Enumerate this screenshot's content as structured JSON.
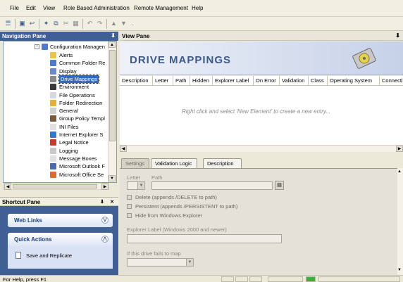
{
  "menu": [
    "File",
    "Edit",
    "View",
    "Role Based Administration",
    "Remote Management",
    "Help"
  ],
  "toolbar": {
    "icons": [
      "list-icon",
      "save-icon",
      "back-icon",
      "wand-icon",
      "copy-icon",
      "cut-icon",
      "paste-icon",
      "undo-icon",
      "redo-icon",
      "up-arrow-icon",
      "down-arrow-icon",
      "more-icon"
    ]
  },
  "nav_pane": {
    "title": "Navigation Pane",
    "pin": "⬇",
    "root": "Configuration Managen",
    "items": [
      {
        "label": "Alerts",
        "color": "#e8c547"
      },
      {
        "label": "Common Folder Re",
        "color": "#4a7bd0"
      },
      {
        "label": "Display",
        "color": "#6a8ad0"
      },
      {
        "label": "Drive Mappings",
        "color": "#8a8a8a",
        "selected": true
      },
      {
        "label": "Environment",
        "color": "#3a3a3a"
      },
      {
        "label": "File Operations",
        "color": "#d8d8d8"
      },
      {
        "label": "Folder Redirection",
        "color": "#e8b030"
      },
      {
        "label": "General",
        "color": "#d0d0d0"
      },
      {
        "label": "Group Policy Templ",
        "color": "#7a5a3a"
      },
      {
        "label": "INI Files",
        "color": "#e0e0e0"
      },
      {
        "label": "Internet Explorer S",
        "color": "#2a7ad8"
      },
      {
        "label": "Legal Notice",
        "color": "#c83a2a"
      },
      {
        "label": "Logging",
        "color": "#c8c8c8"
      },
      {
        "label": "Message Boxes",
        "color": "#e0e0e0"
      },
      {
        "label": "Microsoft Outlook F",
        "color": "#4a6ab0"
      },
      {
        "label": "Microsoft Office Se",
        "color": "#e06a2a"
      }
    ]
  },
  "shortcut_pane": {
    "title": "Shortcut Pane",
    "pin": "⬇",
    "close": "✕",
    "web_links": "Web Links",
    "quick_actions": "Quick Actions",
    "action": "Save and Replicate",
    "chev_down": "⌵",
    "chev_up": "⌃"
  },
  "view_pane": {
    "title": "View Pane",
    "pin": "⬇",
    "banner_title": "DRIVE MAPPINGS",
    "columns": [
      "Description",
      "Letter",
      "Path",
      "Hidden",
      "Explorer Label",
      "On Error",
      "Validation",
      "Class",
      "Operating System",
      "Connecti"
    ],
    "hint": "Right click and select 'New Element' to create a new entry...",
    "tabs": [
      "Settings",
      "Validation Logic",
      "Description"
    ],
    "settings": {
      "letter_label": "Letter",
      "path_label": "Path",
      "delete_opt": "Delete (appends /DELETE to path)",
      "persistent_opt": "Persistent (appends /PERSISTENT to path)",
      "hide_opt": "Hide from Windows Explorer",
      "explorer_label": "Explorer Label (Windows 2000 and newer)",
      "fail_label": "If this drive fails to map"
    }
  },
  "status": {
    "text": "For Help, press F1"
  }
}
